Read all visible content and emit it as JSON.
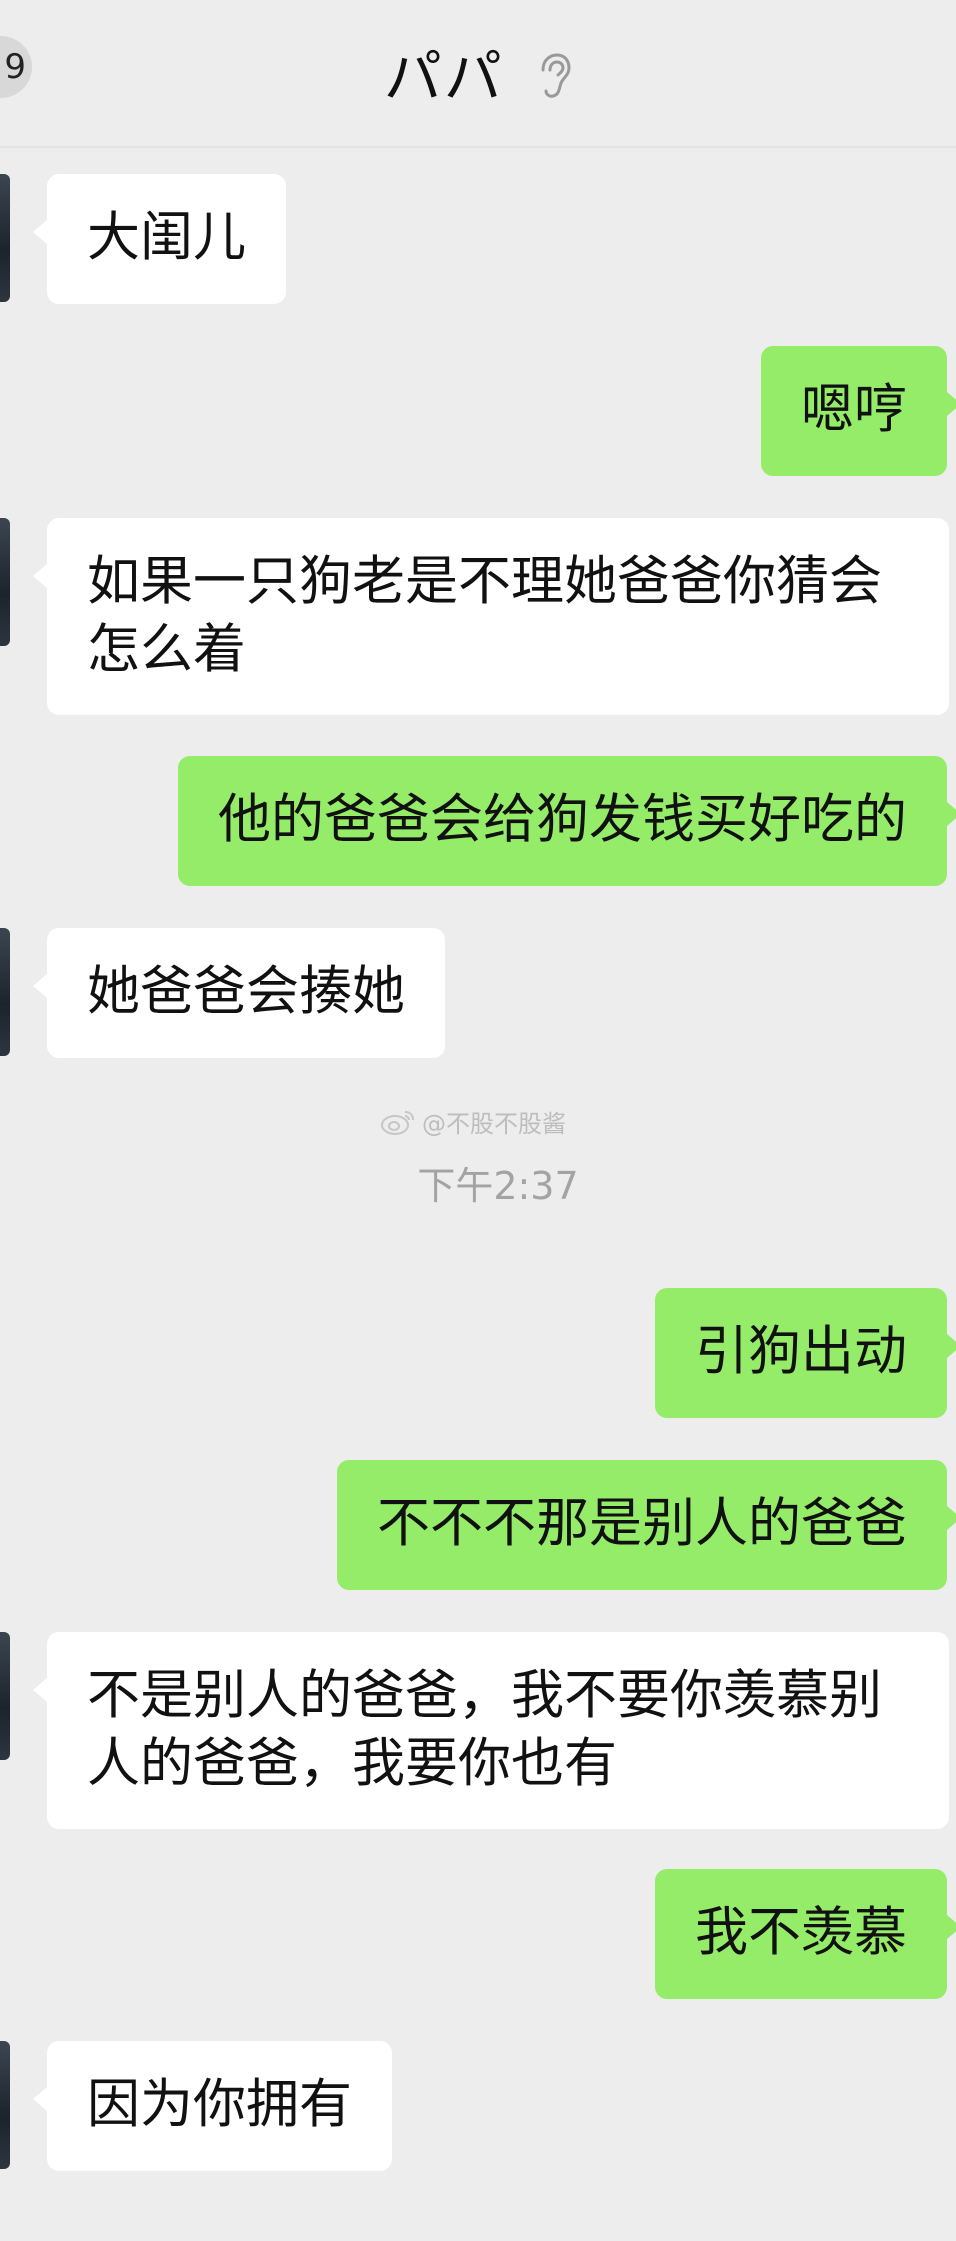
{
  "header": {
    "back_badge": "9",
    "title": "パパ",
    "ear_icon": "ear-icon"
  },
  "messages": [
    {
      "side": "left",
      "text": "大闺儿"
    },
    {
      "side": "right",
      "text": "嗯哼"
    },
    {
      "side": "left",
      "text": "如果一只狗老是不理她爸爸你猜会怎么着"
    },
    {
      "side": "right",
      "text": "他的爸爸会给狗发钱买好吃的"
    },
    {
      "side": "left",
      "text": "她爸爸会揍她"
    },
    {
      "side": "right",
      "text": "引狗出动"
    },
    {
      "side": "right",
      "text": "不不不那是别人的爸爸"
    },
    {
      "side": "left",
      "text": "不是别人的爸爸，我不要你羡慕别人的爸爸，我要你也有"
    },
    {
      "side": "right",
      "text": "我不羡慕"
    },
    {
      "side": "left",
      "text": "因为你拥有"
    }
  ],
  "watermark": "@不股不股酱",
  "timestamp": "下午2:37",
  "colors": {
    "background": "#ededed",
    "bubble_self": "#95ec69",
    "bubble_other": "#ffffff"
  }
}
